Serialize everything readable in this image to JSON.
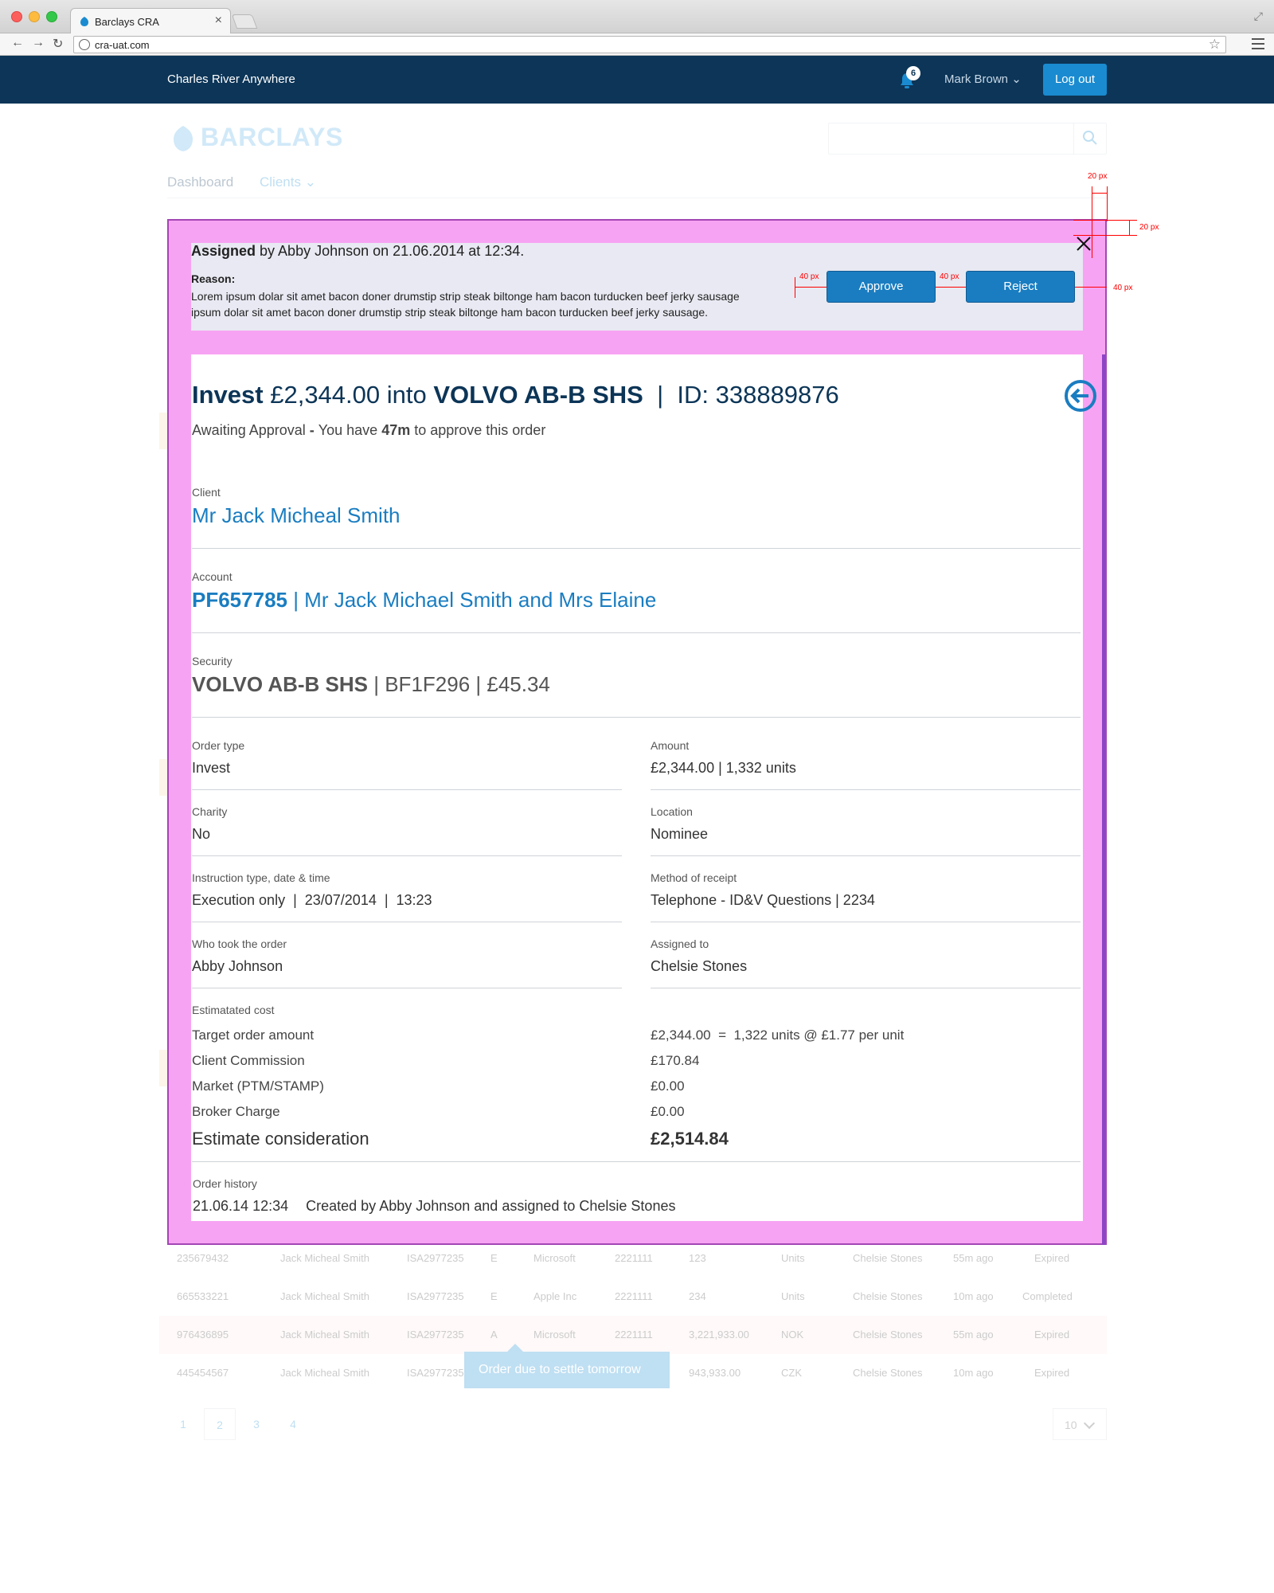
{
  "browser": {
    "tab_title": "Barclays CRA",
    "url": "cra-uat.com"
  },
  "header": {
    "brand": "Charles River Anywhere",
    "notification_count": "6",
    "user_name": "Mark Brown",
    "logout_label": "Log out"
  },
  "page": {
    "logo_text": "BARCLAYS",
    "nav": {
      "dashboard": "Dashboard",
      "clients": "Clients"
    },
    "rows": [
      {
        "id": "235679432",
        "client": "Jack Micheal Smith",
        "account": "ISA2977235",
        "type": "E",
        "security": "Microsoft",
        "code": "2221111",
        "qty": "123",
        "unit": "Units",
        "assignee": "Chelsie Stones",
        "age": "55m ago",
        "status": "Expired"
      },
      {
        "id": "665533221",
        "client": "Jack Micheal Smith",
        "account": "ISA2977235",
        "type": "E",
        "security": "Apple Inc",
        "code": "2221111",
        "qty": "234",
        "unit": "Units",
        "assignee": "Chelsie Stones",
        "age": "10m ago",
        "status": "Completed"
      },
      {
        "id": "976436895",
        "client": "Jack Micheal Smith",
        "account": "ISA2977235",
        "type": "A",
        "security": "Microsoft",
        "code": "2221111",
        "qty": "3,221,933.00",
        "unit": "NOK",
        "assignee": "Chelsie Stones",
        "age": "55m ago",
        "status": "Expired"
      },
      {
        "id": "445454567",
        "client": "Jack Micheal Smith",
        "account": "ISA2977235",
        "type": "",
        "security": "",
        "code": "",
        "qty": "943,933.00",
        "unit": "CZK",
        "assignee": "Chelsie Stones",
        "age": "10m ago",
        "status": "Expired"
      }
    ],
    "tooltip": "Order due to settle tomorrow",
    "pages": [
      "1",
      "2",
      "3",
      "4"
    ],
    "per_page": "10"
  },
  "modal": {
    "assigned_word": "Assigned",
    "assigned_rest": " by Abby Johnson on 21.06.2014 at 12:34.",
    "reason_label": "Reason:",
    "reason_text": "Lorem ipsum dolar sit amet bacon doner drumstip strip steak biltonge ham bacon turducken beef jerky sausage ipsum dolar sit amet bacon doner drumstip strip steak biltonge ham bacon turducken beef jerky sausage.",
    "approve_label": "Approve",
    "reject_label": "Reject",
    "annotations": {
      "top": "20 px",
      "right": "20 px",
      "gap1": "40 px",
      "gap2": "40 px",
      "gap3": "40 px"
    },
    "title": {
      "verb": "Invest",
      "amount": " £2,344.00 into ",
      "security": "VOLVO AB-B SHS",
      "separator": "  |  ",
      "id": "ID: 338889876"
    },
    "status": {
      "prefix": "Awaiting Approval",
      "dash": " - ",
      "pre_time": "You have ",
      "time": "47m",
      "post_time": " to approve this order"
    },
    "client": {
      "label": "Client",
      "value": "Mr Jack Micheal Smith"
    },
    "account": {
      "label": "Account",
      "code": "PF657785",
      "name": " | Mr Jack Michael Smith and Mrs Elaine"
    },
    "security": {
      "label": "Security",
      "name": "VOLVO AB-B SHS",
      "rest": " | BF1F296 | £45.34"
    },
    "fields": {
      "order_type": {
        "label": "Order type",
        "value": "Invest"
      },
      "amount": {
        "label": "Amount",
        "value": "£2,344.00 | 1,332 units"
      },
      "charity": {
        "label": "Charity",
        "value": "No"
      },
      "location": {
        "label": "Location",
        "value": "Nominee"
      },
      "instruction": {
        "label": "Instruction type, date & time",
        "value": "Execution only  |  23/07/2014  |  13:23"
      },
      "method": {
        "label": "Method of receipt",
        "value": "Telephone - ID&V Questions | 2234"
      },
      "who_took": {
        "label": "Who took the order",
        "value": "Abby Johnson"
      },
      "assigned_to": {
        "label": "Assigned to",
        "value": "Chelsie Stones"
      }
    },
    "cost": {
      "label": "Estimatated cost",
      "target_label": "Target order amount",
      "target_value": "£2,344.00  =  1,322 units @ £1.77 per unit",
      "commission_label": "Client Commission",
      "commission_value": "£170.84",
      "market_label": "Market (PTM/STAMP)",
      "market_value": "£0.00",
      "broker_label": "Broker Charge",
      "broker_value": "£0.00",
      "estimate_label": "Estimate consideration",
      "estimate_value": "£2,514.84"
    },
    "history": {
      "label": "Order history",
      "date": "21.06.14 12:34",
      "pre": "Created by ",
      "creator": "Abby Johnson",
      "mid": " and assigned to ",
      "assignee": "Chelsie Stones"
    }
  }
}
